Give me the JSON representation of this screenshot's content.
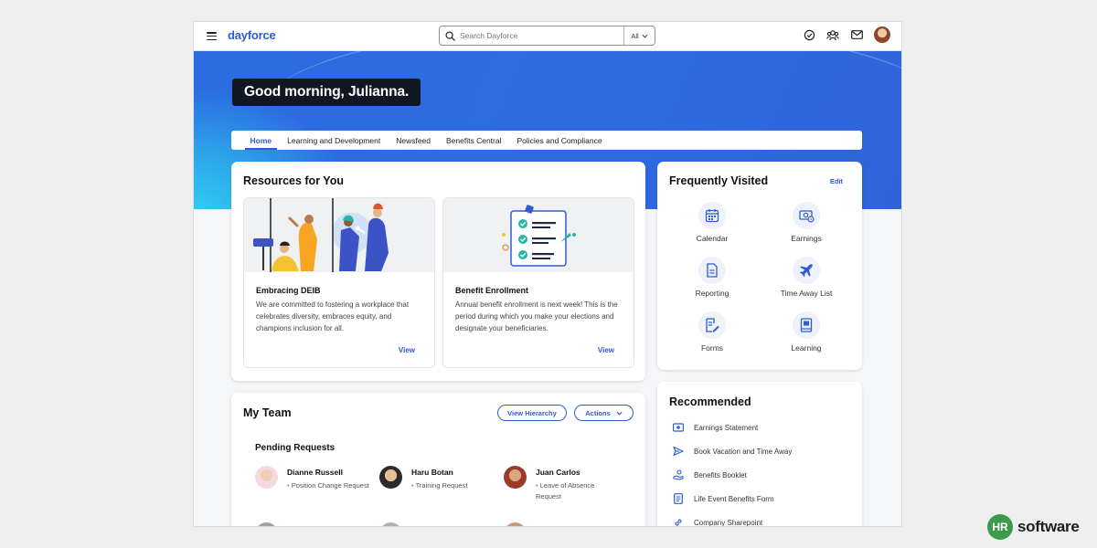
{
  "app": {
    "logo": "dayforce"
  },
  "search": {
    "placeholder": "Search Dayforce",
    "scope": "All"
  },
  "greeting": "Good morning, Julianna.",
  "tabs": [
    {
      "label": "Home",
      "active": true
    },
    {
      "label": "Learning and Development"
    },
    {
      "label": "Newsfeed"
    },
    {
      "label": "Benefits Central"
    },
    {
      "label": "Policies and Compliance"
    }
  ],
  "resources": {
    "title": "Resources for You",
    "items": [
      {
        "title": "Embracing DEIB",
        "desc": "We are committed to fostering a workplace that celebrates diversity, embraces equity, and champions inclusion for all.",
        "view": "View"
      },
      {
        "title": "Benefit Enrollment",
        "desc": "Annual benefit enrollment is next week! This is the period during which you make your elections and designate your beneficiaries.",
        "view": "View"
      }
    ]
  },
  "frequent": {
    "title": "Frequently Visited",
    "edit": "Edit",
    "items": [
      {
        "label": "Calendar",
        "icon": "calendar-icon"
      },
      {
        "label": "Earnings",
        "icon": "earnings-icon"
      },
      {
        "label": "Reporting",
        "icon": "document-icon"
      },
      {
        "label": "Time Away List",
        "icon": "airplane-icon"
      },
      {
        "label": "Forms",
        "icon": "form-edit-icon"
      },
      {
        "label": "Learning",
        "icon": "book-icon"
      }
    ]
  },
  "team": {
    "title": "My Team",
    "view_hierarchy": "View Hierarchy",
    "actions": "Actions",
    "pending_title": "Pending Requests",
    "people": [
      {
        "name": "Dianne Russell",
        "request": "Position Change Request"
      },
      {
        "name": "Haru Botan",
        "request": "Training Request"
      },
      {
        "name": "Juan Carlos",
        "request": "Leave of Absence Request"
      }
    ]
  },
  "recommended": {
    "title": "Recommended",
    "items": [
      {
        "label": "Earnings Statement",
        "icon": "money-icon"
      },
      {
        "label": "Book Vacation and Time Away",
        "icon": "airplane-icon"
      },
      {
        "label": "Benefits Booklet",
        "icon": "benefits-icon"
      },
      {
        "label": "Life Event Benefits Form",
        "icon": "document-icon"
      },
      {
        "label": "Company Sharepoint",
        "icon": "link-icon"
      }
    ]
  },
  "watermark": {
    "badge": "HR",
    "word": "software"
  },
  "colors": {
    "brand": "#2f5bd3",
    "hero": "#2e6be1",
    "accent": "#2fd0f3"
  }
}
